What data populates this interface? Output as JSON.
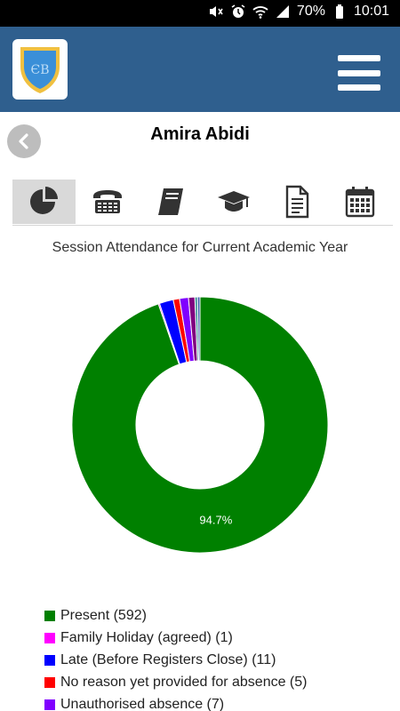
{
  "status_bar": {
    "battery": "70%",
    "time": "10:01",
    "icons": [
      "mute-icon",
      "alarm-icon",
      "wifi-icon",
      "signal-icon",
      "battery-icon"
    ]
  },
  "app_bar": {
    "logo_icon": "school-crest-logo",
    "menu_icon": "hamburger-menu-icon",
    "brand_color": "#2f5f8e"
  },
  "student": {
    "name": "Amira Abidi"
  },
  "tabs": [
    {
      "icon": "pie-chart-icon",
      "active": true
    },
    {
      "icon": "telephone-icon",
      "active": false
    },
    {
      "icon": "book-icon",
      "active": false
    },
    {
      "icon": "graduation-cap-icon",
      "active": false
    },
    {
      "icon": "document-icon",
      "active": false
    },
    {
      "icon": "calendar-icon",
      "active": false
    }
  ],
  "chart_title": "Session Attendance for Current Academic Year",
  "chart_data": {
    "type": "pie",
    "title": "Session Attendance for Current Academic Year",
    "donut": true,
    "slices": [
      {
        "label": "Present",
        "value": 592,
        "color": "#008000",
        "display": "94.7%"
      },
      {
        "label": "Family Holiday (agreed)",
        "value": 1,
        "color": "#ff00ff"
      },
      {
        "label": "Late (Before Registers Close)",
        "value": 11,
        "color": "#0000ff"
      },
      {
        "label": "No reason yet provided for absence",
        "value": 5,
        "color": "#ff0000"
      },
      {
        "label": "Unauthorised absence",
        "value": 7,
        "color": "#8000ff"
      },
      {
        "label": "",
        "value": 5,
        "color": "#800080"
      },
      {
        "label": "",
        "value": 2,
        "color": "#2e8b8b"
      },
      {
        "label": "",
        "value": 2,
        "color": "#4060b0"
      }
    ]
  },
  "legend": [
    {
      "label": "Present (592)",
      "color": "#008000"
    },
    {
      "label": "Family Holiday (agreed) (1)",
      "color": "#ff00ff"
    },
    {
      "label": "Late (Before Registers Close) (11)",
      "color": "#0000ff"
    },
    {
      "label": "No reason yet provided for absence (5)",
      "color": "#ff0000"
    },
    {
      "label": "Unauthorised absence (7)",
      "color": "#8000ff"
    }
  ]
}
